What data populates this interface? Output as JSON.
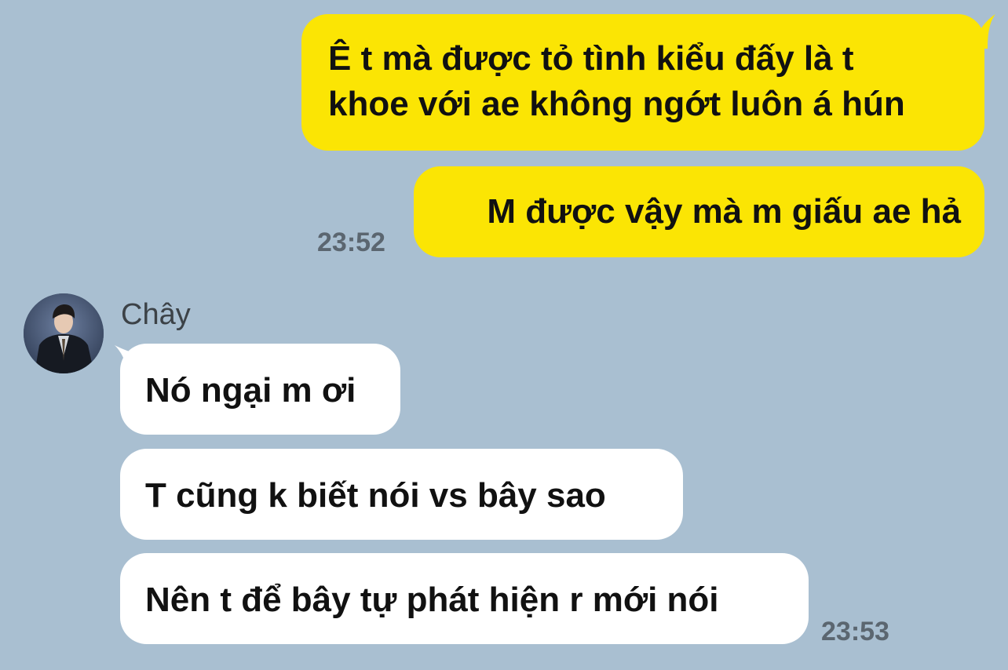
{
  "chat": {
    "colors": {
      "background": "#a9bfd1",
      "sent_bubble": "#fbe504",
      "received_bubble": "#ffffff",
      "timestamp": "#5b6670"
    },
    "outgoing": {
      "messages": [
        {
          "line1": "Ê t mà được tỏ tình kiểu đấy là t",
          "line2": "khoe với ae không ngớt luôn á hún"
        },
        {
          "text": "M được vậy mà m giấu ae hả"
        }
      ],
      "time": "23:52"
    },
    "incoming": {
      "sender_name": "Chây",
      "avatar_icon": "avatar-photo",
      "messages": [
        {
          "text": "Nó ngại m ơi"
        },
        {
          "text": "T cũng k biết nói vs bây sao"
        },
        {
          "text": "Nên t để bây tự phát hiện r mới nói"
        }
      ],
      "time": "23:53"
    }
  }
}
